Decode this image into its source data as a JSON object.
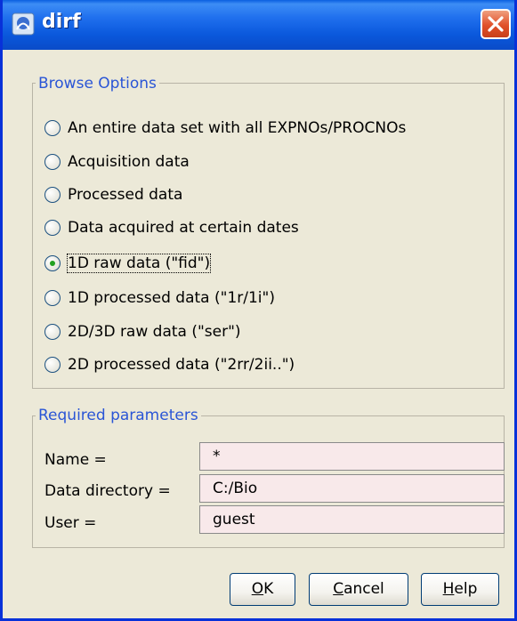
{
  "window": {
    "title": "dirf",
    "icon": "dirf-app-icon",
    "close_icon": "close-icon"
  },
  "browse_options": {
    "legend": "Browse Options",
    "selected_index": 4,
    "options": [
      {
        "label": "An entire data set with all EXPNOs/PROCNOs",
        "checked": false
      },
      {
        "label": "Acquisition data",
        "checked": false
      },
      {
        "label": "Processed data",
        "checked": false
      },
      {
        "label": "Data acquired at certain dates",
        "checked": false
      },
      {
        "label": "1D raw data (\"fid\")",
        "checked": true
      },
      {
        "label": "1D processed data (\"1r/1i\")",
        "checked": false
      },
      {
        "label": "2D/3D raw data (\"ser\")",
        "checked": false
      },
      {
        "label": "2D processed data (\"2rr/2ii..\")",
        "checked": false
      }
    ]
  },
  "required_parameters": {
    "legend": "Required parameters",
    "fields": [
      {
        "label": "Name =",
        "value": "*"
      },
      {
        "label": "Data directory =",
        "value": "C:/Bio"
      },
      {
        "label": "User =",
        "value": "guest"
      }
    ]
  },
  "buttons": {
    "ok": {
      "mnemonic": "O",
      "rest": "K"
    },
    "cancel": {
      "mnemonic": "C",
      "rest": "ancel"
    },
    "help": {
      "mnemonic": "H",
      "rest": "elp"
    }
  },
  "colors": {
    "titlebar": "#0a58dc",
    "legend_text": "#2a55d6",
    "input_bg": "#f8e9ea",
    "dialog_bg": "#ece9d8",
    "radio_checked": "#21a121"
  }
}
